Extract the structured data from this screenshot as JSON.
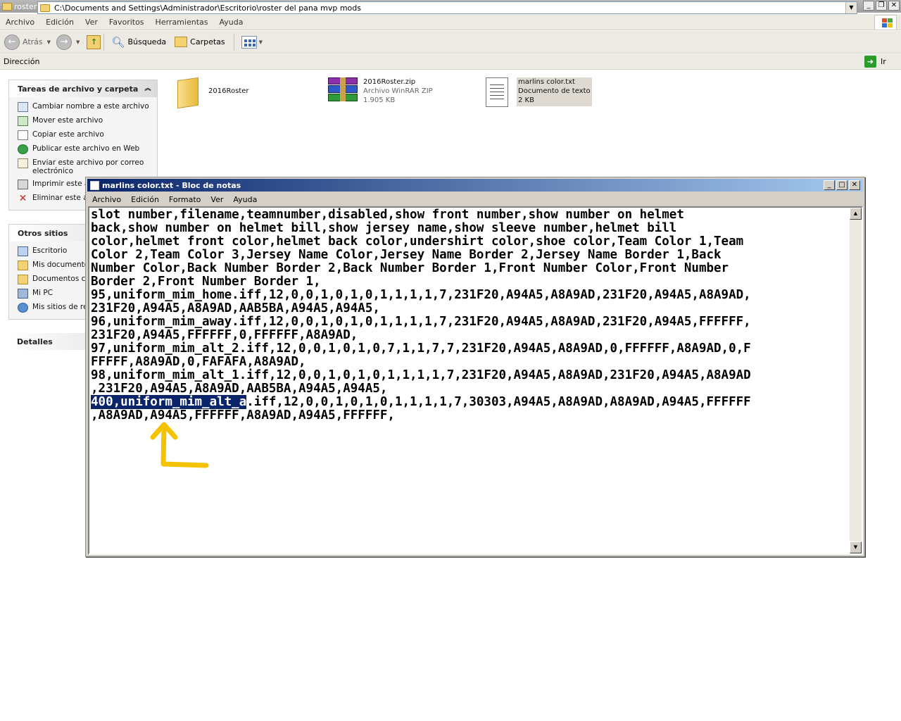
{
  "explorer": {
    "title": "roster del pana mvp mods",
    "menu": [
      "Archivo",
      "Edición",
      "Ver",
      "Favoritos",
      "Herramientas",
      "Ayuda"
    ],
    "toolbar": {
      "back": "Atrás",
      "search": "Búsqueda",
      "folders": "Carpetas"
    },
    "address_label": "Dirección",
    "address": "C:\\Documents and Settings\\Administrador\\Escritorio\\roster del pana mvp mods",
    "go_label": "Ir"
  },
  "tasks_panel": {
    "title": "Tareas de archivo y carpeta",
    "items": [
      {
        "label": "Cambiar nombre a este archivo",
        "icon": "rename-icon"
      },
      {
        "label": "Mover este archivo",
        "icon": "move-icon"
      },
      {
        "label": "Copiar este archivo",
        "icon": "copy-icon"
      },
      {
        "label": "Publicar este archivo en Web",
        "icon": "web-publish-icon"
      },
      {
        "label": "Enviar este archivo por correo electrónico",
        "icon": "email-icon"
      },
      {
        "label": "Imprimir este ar",
        "icon": "print-icon"
      },
      {
        "label": "Eliminar este ar",
        "icon": "delete-icon"
      }
    ]
  },
  "other_places": {
    "title": "Otros sitios",
    "items": [
      {
        "label": "Escritorio",
        "icon": "desktop-icon"
      },
      {
        "label": "Mis documentos",
        "icon": "my-documents-icon"
      },
      {
        "label": "Documentos co",
        "icon": "shared-documents-icon"
      },
      {
        "label": "Mi PC",
        "icon": "my-computer-icon"
      },
      {
        "label": "Mis sitios de red",
        "icon": "network-icon"
      }
    ]
  },
  "details_panel": {
    "title": "Detalles"
  },
  "files": [
    {
      "name": "2016Roster",
      "icon": "folder-icon"
    },
    {
      "name": "2016Roster.zip",
      "type": "Archivo WinRAR ZIP",
      "size": "1.905 KB",
      "icon": "winrar-icon"
    },
    {
      "name": "marlins color.txt",
      "type": "Documento de texto",
      "size": "2 KB",
      "icon": "text-file-icon"
    }
  ],
  "notepad": {
    "title": "marlins color.txt - Bloc de notas",
    "menu": [
      "Archivo",
      "Edición",
      "Formato",
      "Ver",
      "Ayuda"
    ],
    "lines_before": "slot number,filename,teamnumber,disabled,show front number,show number on helmet\nback,show number on helmet bill,show jersey name,show sleeve number,helmet bill\ncolor,helmet front color,helmet back color,undershirt color,shoe color,Team Color 1,Team\nColor 2,Team Color 3,Jersey Name Color,Jersey Name Border 2,Jersey Name Border 1,Back\nNumber Color,Back Number Border 2,Back Number Border 1,Front Number Color,Front Number\nBorder 2,Front Number Border 1,\n95,uniform_mim_home.iff,12,0,0,1,0,1,0,1,1,1,1,7,231F20,A94A5,A8A9AD,231F20,A94A5,A8A9AD,\n231F20,A94A5,A8A9AD,AAB5BA,A94A5,A94A5,\n96,uniform_mim_away.iff,12,0,0,1,0,1,0,1,1,1,1,7,231F20,A94A5,A8A9AD,231F20,A94A5,FFFFFF,\n231F20,A94A5,FFFFFF,0,FFFFFF,A8A9AD,\n97,uniform_mim_alt_2.iff,12,0,0,1,0,1,0,7,1,1,7,7,231F20,A94A5,A8A9AD,0,FFFFFF,A8A9AD,0,F\nFFFFF,A8A9AD,0,FAFAFA,A8A9AD,\n98,uniform_mim_alt_1.iff,12,0,0,1,0,1,0,1,1,1,1,7,231F20,A94A5,A8A9AD,231F20,A94A5,A8A9AD\n,231F20,A94A5,A8A9AD,AAB5BA,A94A5,A94A5,\n",
    "selected_text": "400,uniform_mim_alt_a",
    "lines_after": ".iff,12,0,0,1,0,1,0,1,1,1,1,7,30303,A94A5,A8A9AD,A8A9AD,A94A5,FFFFFF\n,A8A9AD,A94A5,FFFFFF,A8A9AD,A94A5,FFFFFF,"
  },
  "annotation": {
    "color": "#f5c200",
    "icon": "arrow-annotation-icon"
  }
}
